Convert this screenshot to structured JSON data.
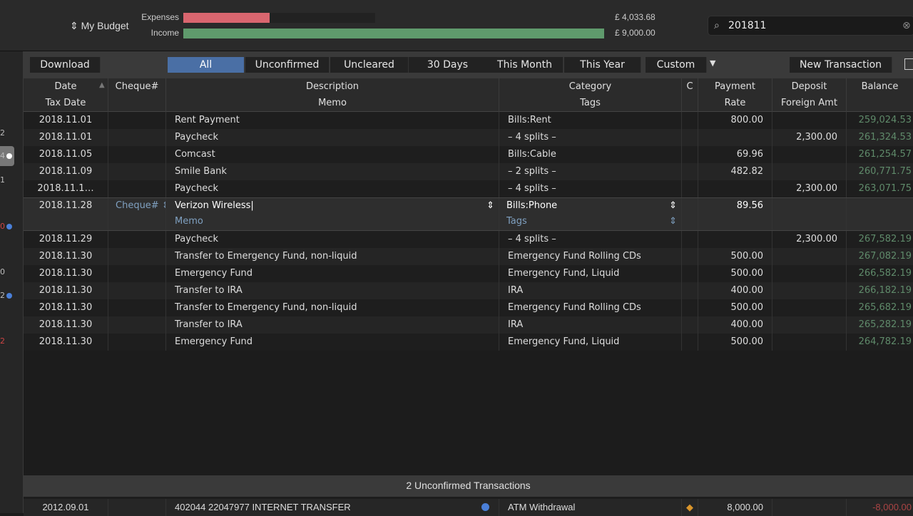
{
  "budget": {
    "name": "My Budget",
    "expenses_label": "Expenses",
    "income_label": "Income",
    "expenses_value": "£ 4,033.68",
    "income_value": "£ 9,000.00",
    "expenses_fraction": 0.45,
    "income_fraction": 1.0,
    "colors": {
      "expenses": "#d9666f",
      "income": "#5f9a6c"
    }
  },
  "search": {
    "value": "201811",
    "icon": "search-icon"
  },
  "sidebar": {
    "counts": [
      "2",
      "4",
      "1",
      "0",
      "0",
      "2",
      "2"
    ]
  },
  "toolbar": {
    "download": "Download",
    "filters": [
      "All",
      "Unconfirmed",
      "Uncleared",
      "30 Days",
      "This Month",
      "This Year",
      "Custom"
    ],
    "active_filter": "All",
    "new_transaction": "New Transaction"
  },
  "columns": {
    "date": "Date",
    "tax_date": "Tax Date",
    "cheque": "Cheque#",
    "description": "Description",
    "memo": "Memo",
    "category": "Category",
    "tags": "Tags",
    "c": "C",
    "payment": "Payment",
    "rate": "Rate",
    "deposit": "Deposit",
    "foreign": "Foreign Amt",
    "balance": "Balance"
  },
  "transactions_before": [
    {
      "date": "2018.11.01",
      "desc": "Rent Payment",
      "cat": "Bills:Rent",
      "payment": "800.00",
      "deposit": "",
      "balance": "259,024.53"
    },
    {
      "date": "2018.11.01",
      "desc": "Paycheck",
      "cat": "– 4 splits –",
      "payment": "",
      "deposit": "2,300.00",
      "balance": "261,324.53"
    },
    {
      "date": "2018.11.05",
      "desc": "Comcast",
      "cat": "Bills:Cable",
      "payment": "69.96",
      "deposit": "",
      "balance": "261,254.57"
    },
    {
      "date": "2018.11.09",
      "desc": "Smile Bank",
      "cat": "– 2 splits –",
      "payment": "482.82",
      "deposit": "",
      "balance": "260,771.75"
    },
    {
      "date": "2018.11.1…",
      "desc": "Paycheck",
      "cat": "– 4 splits –",
      "payment": "",
      "deposit": "2,300.00",
      "balance": "263,071.75"
    }
  ],
  "editing": {
    "date": "2018.11.28",
    "cheque_placeholder": "Cheque#",
    "desc": "Verizon Wireless",
    "memo_placeholder": "Memo",
    "cat": "Bills:Phone",
    "tags_placeholder": "Tags",
    "payment": "89.56"
  },
  "transactions_after": [
    {
      "date": "2018.11.29",
      "desc": "Paycheck",
      "cat": "– 4 splits –",
      "payment": "",
      "deposit": "2,300.00",
      "balance": "267,582.19"
    },
    {
      "date": "2018.11.30",
      "desc": "Transfer to Emergency Fund, non-liquid",
      "cat": "Emergency Fund Rolling CDs",
      "payment": "500.00",
      "deposit": "",
      "balance": "267,082.19"
    },
    {
      "date": "2018.11.30",
      "desc": "Emergency Fund",
      "cat": "Emergency Fund, Liquid",
      "payment": "500.00",
      "deposit": "",
      "balance": "266,582.19"
    },
    {
      "date": "2018.11.30",
      "desc": "Transfer to IRA",
      "cat": "IRA",
      "payment": "400.00",
      "deposit": "",
      "balance": "266,182.19"
    },
    {
      "date": "2018.11.30",
      "desc": "Transfer to Emergency Fund, non-liquid",
      "cat": "Emergency Fund Rolling CDs",
      "payment": "500.00",
      "deposit": "",
      "balance": "265,682.19"
    },
    {
      "date": "2018.11.30",
      "desc": "Transfer to IRA",
      "cat": "IRA",
      "payment": "400.00",
      "deposit": "",
      "balance": "265,282.19"
    },
    {
      "date": "2018.11.30",
      "desc": "Emergency Fund",
      "cat": "Emergency Fund, Liquid",
      "payment": "500.00",
      "deposit": "",
      "balance": "264,782.19"
    }
  ],
  "unconfirmed": {
    "title": "2 Unconfirmed Transactions",
    "row": {
      "date": "2012.09.01",
      "desc": "402044 22047977 INTERNET TRANSFER",
      "cat": "ATM Withdrawal",
      "payment": "8,000.00",
      "balance": "-8,000.00"
    }
  }
}
